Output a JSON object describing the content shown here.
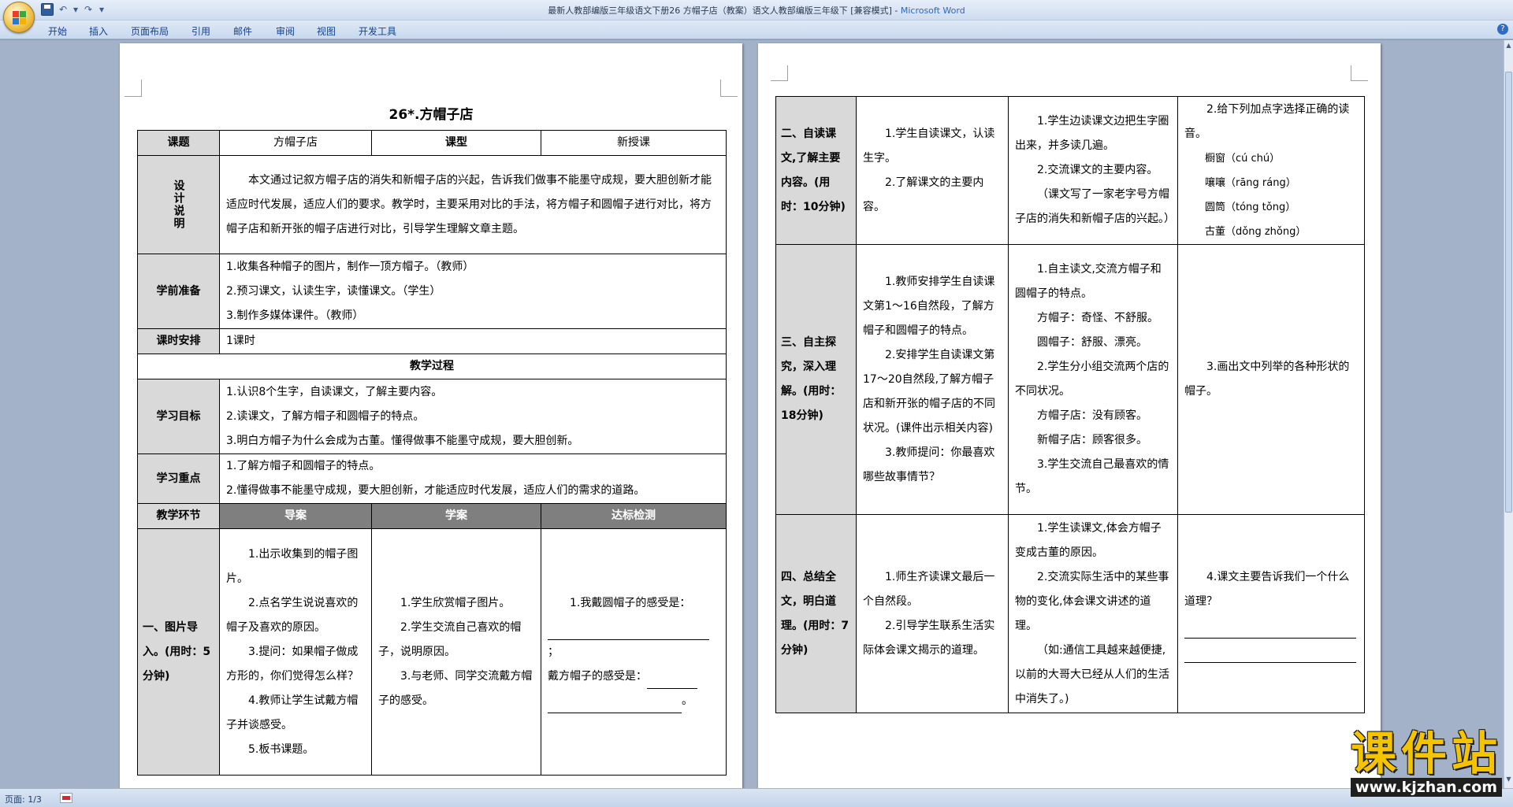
{
  "window": {
    "title": "最新人教部编版三年级语文下册26 方帽子店（教案）语文人教部编版三年级下 [兼容模式] - Microsoft Word",
    "title_doc": "最新人教部编版三年级语文下册26 方帽子店（教案）语文人教部编版三年级下 [兼容模式] - ",
    "title_app": "Microsoft Word"
  },
  "quick_access": {
    "undo": "↶",
    "undo_drop": "▾",
    "redo": "↷",
    "customize": "▾"
  },
  "ribbon_tabs": [
    "开始",
    "插入",
    "页面布局",
    "引用",
    "邮件",
    "审阅",
    "视图",
    "开发工具"
  ],
  "help": "?",
  "status": {
    "page": "页面: 1/3"
  },
  "watermark": {
    "name": "课件站",
    "url": "www.kjzhan.com"
  },
  "mark": "↵",
  "page1": {
    "title": "26*.方帽子店",
    "row1": {
      "label": "课题",
      "v1": "方帽子店",
      "label2": "课型",
      "v2": "新授课"
    },
    "design": {
      "label": "设计说明",
      "text": "本文通过记叙方帽子店的消失和新帽子店的兴起，告诉我们做事不能墨守成规，要大胆创新才能适应时代发展，适应人们的要求。教学时，主要采用对比的手法，将方帽子和圆帽子进行对比，将方帽子店和新开张的帽子店进行对比，引导学生理解文章主题。"
    },
    "prep": {
      "label": "学前准备",
      "items": [
        "1.收集各种帽子的图片，制作一顶方帽子。（教师）",
        "2.预习课文，认读生字，读懂课文。（学生）",
        "3.制作多媒体课件。（教师）"
      ]
    },
    "time": {
      "label": "课时安排",
      "value": "1课时"
    },
    "process": "教学过程",
    "goals": {
      "label": "学习目标",
      "items": [
        "1.认识8个生字，自读课文，了解主要内容。",
        "2.读课文，了解方帽子和圆帽子的特点。",
        "3.明白方帽子为什么会成为古董。懂得做事不能墨守成规，要大胆创新。"
      ]
    },
    "key": {
      "label": "学习重点",
      "items": [
        "1.了解方帽子和圆帽子的特点。",
        "2.懂得做事不能墨守成规，要大胆创新，才能适应时代发展，适应人们的需求的道路。"
      ]
    },
    "header": {
      "c1": "教学环节",
      "c2": "导案",
      "c3": "学案",
      "c4": "达标检测"
    },
    "step1": {
      "label": "一、图片导入。(用时：5分钟)",
      "guide": [
        "1.出示收集到的帽子图片。",
        "2.点名学生说说喜欢的帽子及喜欢的原因。",
        "3.提问：如果帽子做成方形的，你们觉得怎么样？",
        "4.教师让学生试戴方帽子并谈感受。",
        "5.板书课题。"
      ],
      "study": [
        "1.学生欣赏帽子图片。",
        "2.学生交流自己喜欢的帽子，说明原因。",
        "3.与老师、同学交流戴方帽子的感受。"
      ],
      "check": {
        "q1": "1.我戴圆帽子的感受是：",
        "semi": "；",
        "q2": "戴方帽子的感受是：",
        "end": "。"
      }
    }
  },
  "page2": {
    "rows": [
      {
        "label": "二、自读课文,了解主要内容。(用时：10分钟)",
        "guide": [
          "1.学生自读课文，认读生字。",
          "2.了解课文的主要内容。"
        ],
        "study": [
          "1.学生边读课文边把生字圈出来，并多读几遍。",
          "2.交流课文的主要内容。",
          "（课文写了一家老字号方帽子店的消失和新帽子店的兴起。）"
        ],
        "check": [
          "2.给下列加点字选择正确的读音。",
          "橱窗（cú  chú）",
          "嚷嚷（rāng  ráng）",
          "圆筒（tóng  tǒng）",
          "古董（dǒng  zhǒng）"
        ]
      },
      {
        "label": "三、自主探究，深入理解。(用时：18分钟)",
        "guide": [
          "1.教师安排学生自读课文第1～16自然段，了解方帽子和圆帽子的特点。",
          "2.安排学生自读课文第17～20自然段,了解方帽子店和新开张的帽子店的不同状况。(课件出示相关内容)",
          "3.教师提问：你最喜欢哪些故事情节？"
        ],
        "study": [
          "1.自主读文,交流方帽子和圆帽子的特点。",
          "方帽子：奇怪、不舒服。",
          "圆帽子：舒服、漂亮。",
          "2.学生分小组交流两个店的不同状况。",
          "方帽子店：没有顾客。",
          "新帽子店：顾客很多。",
          "3.学生交流自己最喜欢的情节。"
        ],
        "check": [
          "3.画出文中列举的各种形状的帽子。"
        ]
      },
      {
        "label": "四、总结全文，明白道理。(用时：7分钟)",
        "guide": [
          "1.师生齐读课文最后一个自然段。",
          "2.引导学生联系生活实际体会课文揭示的道理。"
        ],
        "study": [
          "1.学生读课文,体会方帽子变成古董的原因。",
          "2.交流实际生活中的某些事物的变化,体会课文讲述的道理。",
          "（如:通信工具越来越便捷,以前的大哥大已经从人们的生活中消失了。)"
        ],
        "check": [
          "4.课文主要告诉我们一个什么道理？"
        ]
      }
    ]
  }
}
